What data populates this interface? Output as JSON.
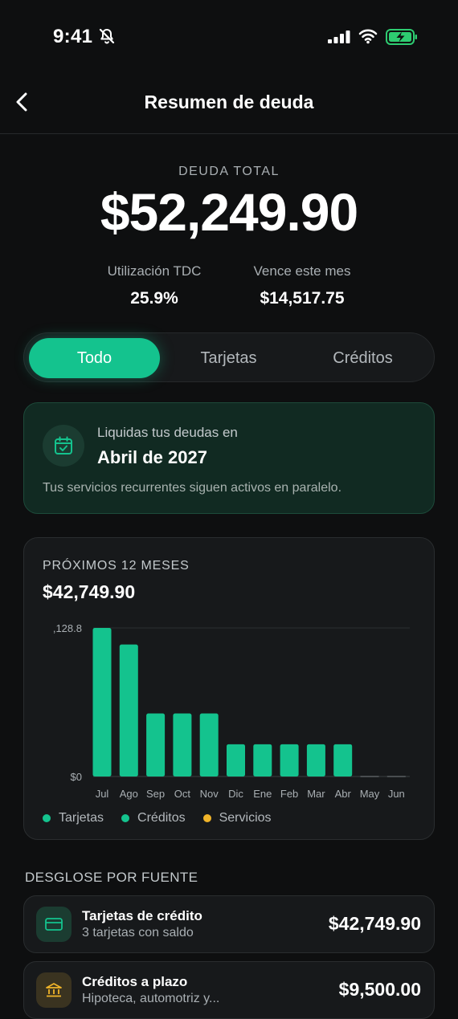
{
  "status_bar": {
    "time": "9:41"
  },
  "nav": {
    "title": "Resumen de deuda",
    "back_icon": "chevron-left-icon"
  },
  "summary": {
    "label": "DEUDA TOTAL",
    "amount": "$52,249.90",
    "stats": [
      {
        "label": "Utilización TDC",
        "value": "25.9%"
      },
      {
        "label": "Vence este mes",
        "value": "$14,517.75"
      }
    ]
  },
  "tabs": [
    {
      "label": "Todo",
      "active": true
    },
    {
      "label": "Tarjetas",
      "active": false
    },
    {
      "label": "Créditos",
      "active": false
    }
  ],
  "payoff": {
    "icon": "calendar-check-icon",
    "pre": "Liquidas tus deudas en",
    "date": "Abril de 2027",
    "note": "Tus servicios recurrentes siguen activos en paralelo."
  },
  "chart_card": {
    "heading": "PRÓXIMOS 12 MESES",
    "total": "$42,749.90"
  },
  "chart_data": {
    "type": "bar",
    "categories": [
      "Jul",
      "Ago",
      "Sep",
      "Oct",
      "Nov",
      "Dic",
      "Ene",
      "Feb",
      "Mar",
      "Abr",
      "May",
      "Jun"
    ],
    "series": [
      {
        "name": "Tarjetas",
        "values": [
          10128.8,
          9000,
          4300,
          4300,
          4300,
          2200,
          2200,
          2200,
          2200,
          2200,
          0,
          0
        ]
      },
      {
        "name": "Créditos",
        "values": [
          0,
          0,
          0,
          0,
          0,
          0,
          0,
          0,
          0,
          0,
          0,
          0
        ]
      },
      {
        "name": "Servicios",
        "values": [
          0,
          0,
          0,
          0,
          0,
          0,
          0,
          0,
          0,
          0,
          0,
          0
        ]
      }
    ],
    "ytick_labels": [
      ",128.8",
      "$0"
    ],
    "ylim": [
      0,
      10128.8
    ],
    "colors": {
      "Tarjetas": "#14c38e",
      "Créditos": "#14c38e",
      "Servicios": "#f0b429"
    },
    "grid": true,
    "legend_position": "bottom-left"
  },
  "sources": {
    "title": "DESGLOSE POR FUENTE",
    "items": [
      {
        "icon": "credit-card-icon",
        "name": "Tarjetas de crédito",
        "subtitle": "3 tarjetas con saldo",
        "amount": "$42,749.90"
      },
      {
        "icon": "bank-icon",
        "name": "Créditos a plazo",
        "subtitle": "Hipoteca, automotriz y...",
        "amount": "$9,500.00"
      }
    ]
  },
  "colors": {
    "accent": "#14c38e",
    "background": "#0e0f10",
    "card": "#17191b"
  }
}
